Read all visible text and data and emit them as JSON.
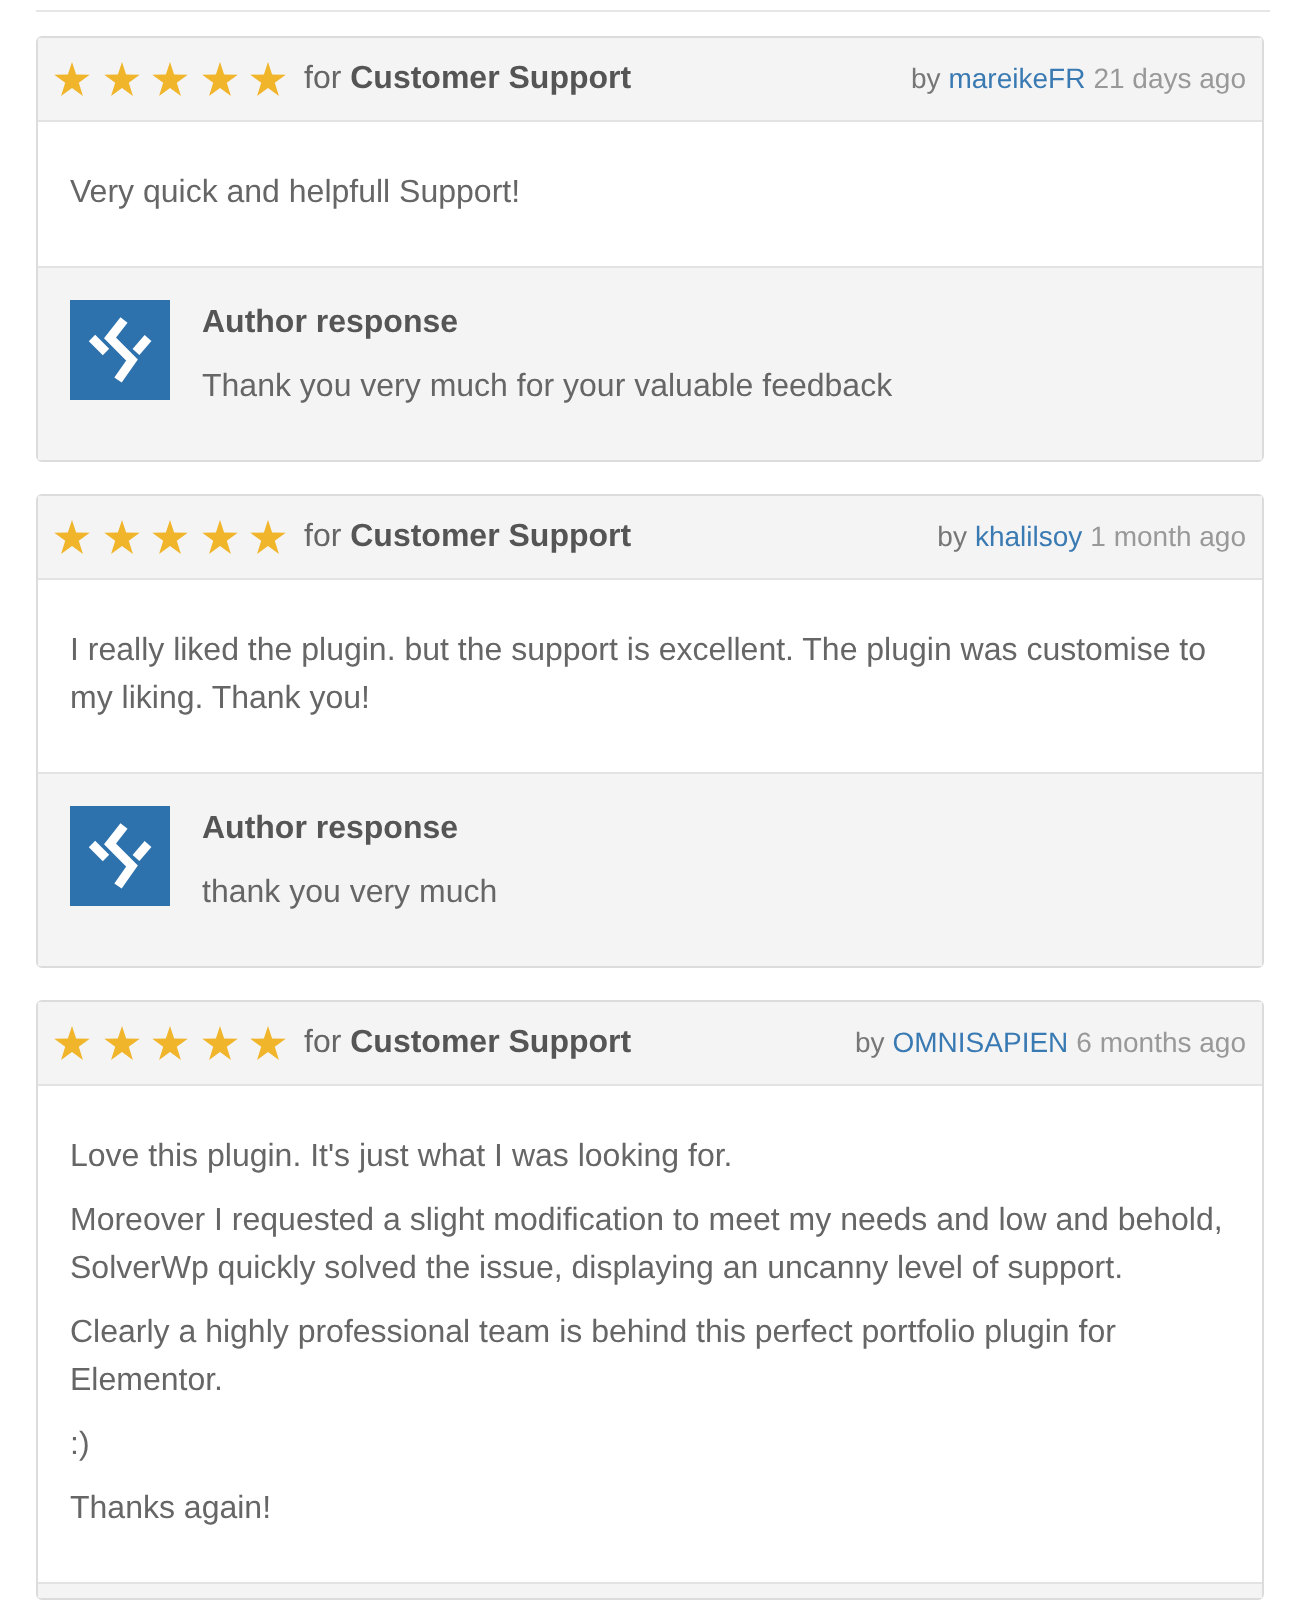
{
  "reviews": [
    {
      "stars": 5,
      "heading": "for **Customer Support**",
      "by": "by",
      "author": "mareikeFR",
      "date": "21 days ago",
      "paragraphs": [
        "Very quick and helpfull Support!"
      ],
      "has_response": true,
      "response": {
        "title": "Author response",
        "text": "Thank you very much for your valuable feedback"
      }
    },
    {
      "stars": 5,
      "heading": "for **Customer Support**",
      "by": "by",
      "author": "khalilsoy",
      "date": "1 month ago",
      "paragraphs": [
        "I really liked the plugin. but the support is excellent. The plugin was customise to my liking. Thank you!"
      ],
      "has_response": true,
      "response": {
        "title": "Author response",
        "text": "thank you very much"
      }
    },
    {
      "stars": 5,
      "heading": "for **Customer Support**",
      "by": "by",
      "author": "OMNISAPIEN",
      "date": "6 months ago",
      "paragraphs": [
        "Love this plugin. It's just what I was looking for.",
        "Moreover I requested a slight modification to meet my needs and low and behold, SolverWp quickly solved the issue, displaying an uncanny level of support.",
        "Clearly a highly professional team is behind this perfect portfolio plugin for Elementor.",
        ":)",
        "Thanks again!"
      ],
      "has_response": true
    }
  ]
}
